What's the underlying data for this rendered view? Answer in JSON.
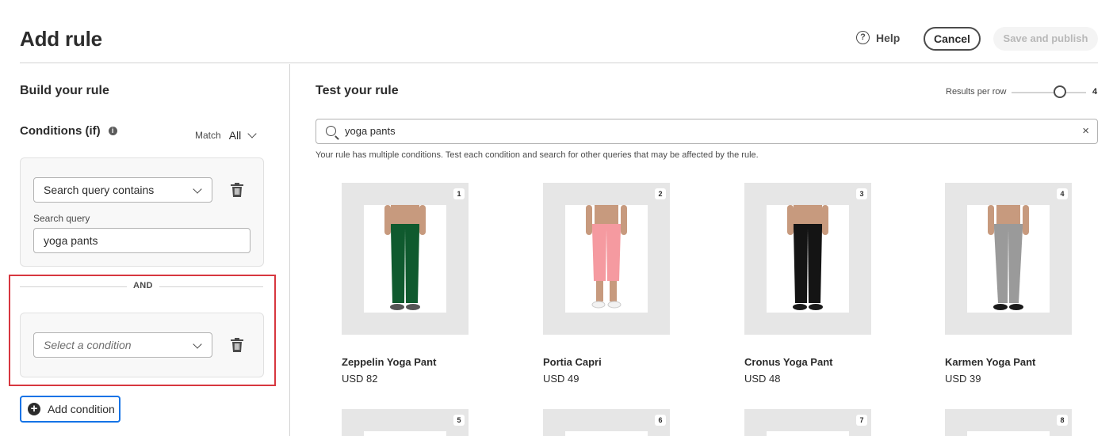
{
  "header": {
    "title": "Add rule",
    "help_label": "Help",
    "help_glyph": "?",
    "cancel_label": "Cancel",
    "publish_label": "Save and publish"
  },
  "build": {
    "title": "Build your rule",
    "conditions_title": "Conditions (if)",
    "info_glyph": "i",
    "match_label": "Match",
    "match_value": "All",
    "condition1": {
      "type_value": "Search query contains",
      "query_label": "Search query",
      "query_value": "yoga pants"
    },
    "and_label": "AND",
    "condition2": {
      "type_placeholder": "Select a condition"
    },
    "add_condition_label": "Add condition",
    "plus_glyph": "+"
  },
  "test": {
    "title": "Test your rule",
    "results_per_row_label": "Results per row",
    "results_per_row_value": "4",
    "search_value": "yoga pants",
    "clear_glyph": "×",
    "hint": "Your rule has multiple conditions. Test each condition and search for other queries that may be affected by the rule."
  },
  "products": [
    {
      "rank": "1",
      "name": "Zeppelin Yoga Pant",
      "price": "USD 82",
      "pant_color": "#0f5a2e",
      "style": "long"
    },
    {
      "rank": "2",
      "name": "Portia Capri",
      "price": "USD 49",
      "pant_color": "#f59aa0",
      "style": "capri"
    },
    {
      "rank": "3",
      "name": "Cronus Yoga Pant",
      "price": "USD 48",
      "pant_color": "#141414",
      "style": "jogger"
    },
    {
      "rank": "4",
      "name": "Karmen Yoga Pant",
      "price": "USD 39",
      "pant_color": "#9a9a9a",
      "style": "legging"
    }
  ],
  "products_row2": [
    {
      "rank": "5"
    },
    {
      "rank": "6"
    },
    {
      "rank": "7"
    },
    {
      "rank": "8"
    }
  ],
  "colors": {
    "accent_blue": "#1473e6",
    "highlight_red": "#d7373f"
  }
}
